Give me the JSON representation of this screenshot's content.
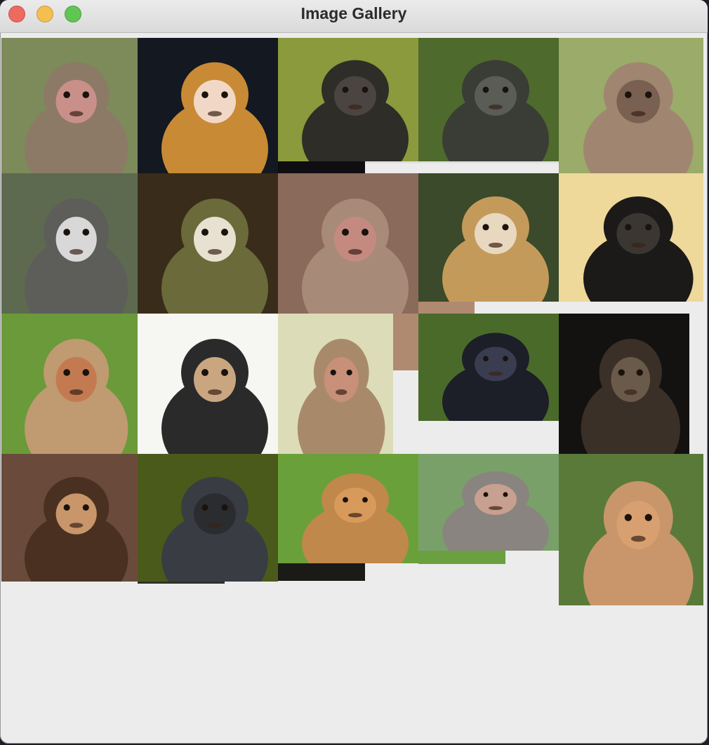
{
  "window": {
    "title": "Image Gallery",
    "controls": {
      "close": "close-button",
      "minimize": "minimize-button",
      "zoom": "zoom-button"
    }
  },
  "gallery": {
    "tiles": [
      {
        "name": "macaque-family",
        "bg": "#7d8a5a",
        "fur": "#8c7a66",
        "face": "#c9908a"
      },
      {
        "name": "orange-baby-monkey",
        "bg": "#141820",
        "fur": "#c98a35",
        "face": "#f1d8c6"
      },
      {
        "name": "monkey-in-leaves",
        "bg": "#8a9a3c",
        "fur": "#2e2d28",
        "face": "#4a4540"
      },
      {
        "name": "grinning-gray-monkey",
        "bg": "#4e6a2c",
        "fur": "#3a3c36",
        "face": "#5a5c56"
      },
      {
        "name": "brown-monkey-side",
        "bg": "#9aab6a",
        "fur": "#a08670",
        "face": "#7a6050"
      },
      {
        "name": "emperor-tamarin",
        "bg": "#5d6a50",
        "fur": "#5d5d5a",
        "face": "#d8d8d8"
      },
      {
        "name": "squirrel-monkey-closeup",
        "bg": "#3a2c1a",
        "fur": "#6b6a3a",
        "face": "#e8e0d0"
      },
      {
        "name": "macaque-face",
        "bg": "#8a6a5a",
        "fur": "#a88a78",
        "face": "#c48a80"
      },
      {
        "name": "squirrel-monkey-rope",
        "bg": "#3a4a2a",
        "fur": "#c49a5a",
        "face": "#e8d8c0"
      },
      {
        "name": "black-monkey-yellow-bg",
        "bg": "#eed89a",
        "fur": "#1c1a18",
        "face": "#3a3632"
      },
      {
        "name": "proboscis-monkey",
        "bg": "#6a9a3a",
        "fur": "#c09a70",
        "face": "#c47a50"
      },
      {
        "name": "monkey-illustrations",
        "bg": "#f6f6f2",
        "fur": "#2a2a2a",
        "face": "#caa680"
      },
      {
        "name": "bonnet-macaque",
        "bg": "#dcdcb8",
        "fur": "#a88a6a",
        "face": "#c89078"
      },
      {
        "name": "black-macaque",
        "bg": "#4a6a2a",
        "fur": "#1c1e28",
        "face": "#3a3c50"
      },
      {
        "name": "spider-monkeys",
        "bg": "#141210",
        "fur": "#3a3028",
        "face": "#6a5a4a"
      },
      {
        "name": "chimp-waiter",
        "bg": "#6a4a3a",
        "fur": "#4a3020",
        "face": "#c8966a"
      },
      {
        "name": "blue-monkey",
        "bg": "#4a5a1a",
        "fur": "#3a3c44",
        "face": "#2a2c30"
      },
      {
        "name": "proboscis-profile",
        "bg": "#6aa03a",
        "fur": "#c0884a",
        "face": "#d89a5a"
      },
      {
        "name": "long-tailed-macaque",
        "bg": "#7aa06a",
        "fur": "#8a8480",
        "face": "#c8a090"
      },
      {
        "name": "proboscis-yawn",
        "bg": "#5a7a3a",
        "fur": "#c8966a",
        "face": "#d8a070"
      }
    ]
  }
}
